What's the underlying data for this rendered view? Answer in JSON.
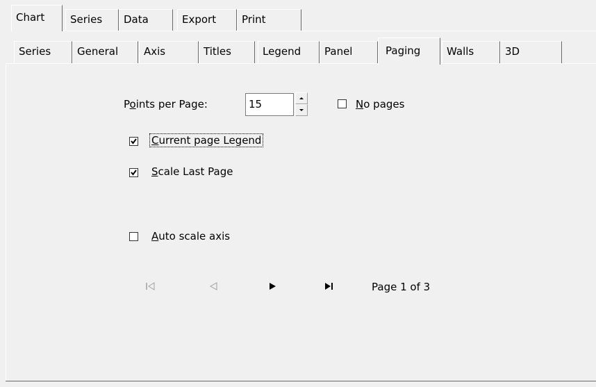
{
  "top_tabs": [
    "Chart",
    "Series",
    "Data",
    "Export",
    "Print"
  ],
  "sub_tabs": [
    "Series",
    "General",
    "Axis",
    "Titles",
    "Legend",
    "Panel",
    "Paging",
    "Walls",
    "3D"
  ],
  "active_sub_tab": "Paging",
  "paging": {
    "points_per_page": {
      "label_prefix": "P",
      "label_underline": "o",
      "label_rest": "ints per Page:",
      "value": "15"
    },
    "no_pages": {
      "underline": "N",
      "rest": "o pages",
      "checked": false
    },
    "current_page_legend": {
      "underline": "C",
      "rest": "urrent page Legend",
      "checked": true
    },
    "scale_last_page": {
      "underline": "S",
      "rest": "cale Last Page",
      "checked": true
    },
    "auto_scale_axis": {
      "underline": "A",
      "rest": "uto scale axis",
      "checked": false
    },
    "navigator": {
      "icons": [
        "first-page-icon",
        "previous-page-icon",
        "next-page-icon",
        "last-page-icon"
      ],
      "enabled": [
        false,
        false,
        true,
        true
      ],
      "page_text": "Page 1 of 3"
    }
  },
  "colors": {
    "face": "#f0f0f0",
    "highlight": "#ffffff",
    "shadow": "#696969",
    "disabled": "#a0a0a0"
  }
}
